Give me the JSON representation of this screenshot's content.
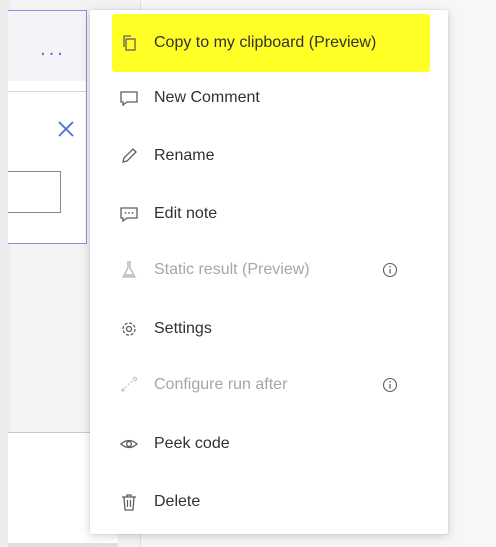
{
  "card": {
    "more_label": "..."
  },
  "menu": {
    "items": [
      {
        "label": "Copy to my clipboard (Preview)",
        "icon": "copy-icon",
        "enabled": true,
        "highlighted": true
      },
      {
        "label": "New Comment",
        "icon": "comment-icon",
        "enabled": true
      },
      {
        "label": "Rename",
        "icon": "pencil-icon",
        "enabled": true
      },
      {
        "label": "Edit note",
        "icon": "note-icon",
        "enabled": true
      },
      {
        "label": "Static result (Preview)",
        "icon": "flask-icon",
        "enabled": false,
        "info": true
      },
      {
        "label": "Settings",
        "icon": "gear-icon",
        "enabled": true
      },
      {
        "label": "Configure run after",
        "icon": "run-after-icon",
        "enabled": false,
        "info": true
      },
      {
        "label": "Peek code",
        "icon": "eye-icon",
        "enabled": true
      },
      {
        "label": "Delete",
        "icon": "trash-icon",
        "enabled": true
      }
    ]
  },
  "colors": {
    "highlight": "#ffff26",
    "accent": "#4a6fd1",
    "card_border": "#8f8fd9",
    "text": "#323130",
    "disabled_text": "#a8a6a4"
  }
}
